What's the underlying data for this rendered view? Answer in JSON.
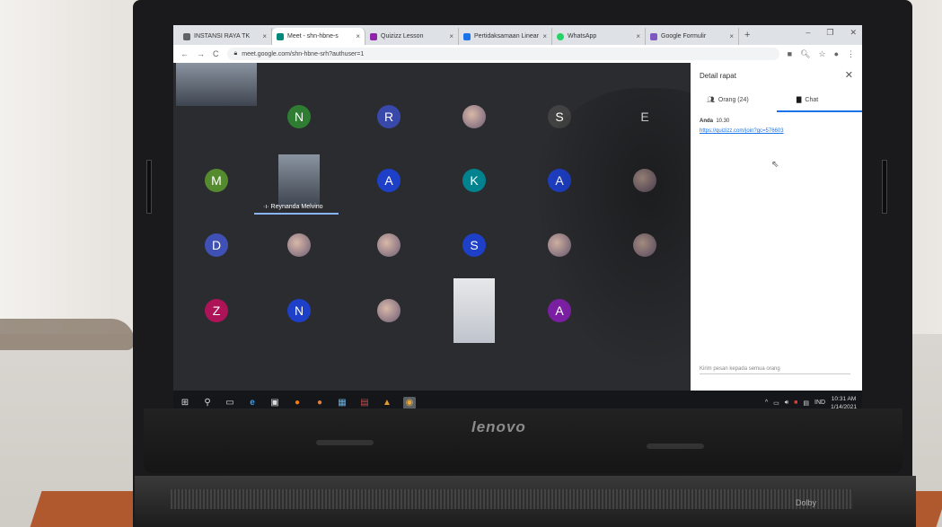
{
  "browser": {
    "tabs": [
      {
        "label": "INSTANSI RAYA TK",
        "favicon_color": "#5f6368",
        "active": false
      },
      {
        "label": "Meet - shn-hbne-s",
        "favicon_color": "#00897b",
        "active": true
      },
      {
        "label": "Quizizz Lesson",
        "favicon_color": "#8e24aa",
        "active": false
      },
      {
        "label": "Pertidaksamaan Linear",
        "favicon_color": "#1a73e8",
        "active": false
      },
      {
        "label": "WhatsApp",
        "favicon_color": "#25d366",
        "active": false
      },
      {
        "label": "Google Formulir",
        "favicon_color": "#7e57c2",
        "active": false
      }
    ],
    "new_tab_label": "+",
    "url": "meet.google.com/shn-hbne-srh?authuser=1"
  },
  "meet": {
    "participants": [
      {
        "type": "video",
        "name": ""
      },
      {
        "type": "avatar",
        "initial": "N",
        "color": "#2e7d32"
      },
      {
        "type": "avatar",
        "initial": "R",
        "color": "#3949ab"
      },
      {
        "type": "photo",
        "initial": ""
      },
      {
        "type": "avatar",
        "initial": "S",
        "color": "#424242"
      },
      {
        "type": "avatar",
        "initial": "E",
        "color": "#2b2c2f"
      },
      {
        "type": "avatar",
        "initial": "M",
        "color": "#558b2f"
      },
      {
        "type": "video-named",
        "name": "Reynanda Melvino"
      },
      {
        "type": "avatar",
        "initial": "A",
        "color": "#1e40c8"
      },
      {
        "type": "avatar",
        "initial": "K",
        "color": "#00838f"
      },
      {
        "type": "avatar",
        "initial": "A",
        "color": "#1e40c8"
      },
      {
        "type": "photo",
        "initial": ""
      },
      {
        "type": "avatar",
        "initial": "D",
        "color": "#3f51b5"
      },
      {
        "type": "photo",
        "initial": ""
      },
      {
        "type": "photo",
        "initial": ""
      },
      {
        "type": "avatar",
        "initial": "S",
        "color": "#1e40c8"
      },
      {
        "type": "photo",
        "initial": ""
      },
      {
        "type": "photo",
        "initial": ""
      },
      {
        "type": "avatar",
        "initial": "Z",
        "color": "#ad1457"
      },
      {
        "type": "avatar",
        "initial": "N",
        "color": "#1e40c8"
      },
      {
        "type": "photo",
        "initial": ""
      },
      {
        "type": "video",
        "name": ""
      },
      {
        "type": "avatar",
        "initial": "A",
        "color": "#7b1fa2"
      }
    ]
  },
  "panel": {
    "title": "Detail rapat",
    "people_tab": "Orang (24)",
    "chat_tab": "Chat",
    "message": {
      "sender": "Anda",
      "time": "10.30",
      "text": "https://quizizz.com/join?gc=576603"
    },
    "input_placeholder": "Kirim pesan kepada semua orang"
  },
  "taskbar": {
    "tray_lang": "IND",
    "time": "10:31 AM",
    "date": "1/14/2021"
  },
  "laptop": {
    "brand": "lenovo",
    "base_label": "Dolby"
  }
}
